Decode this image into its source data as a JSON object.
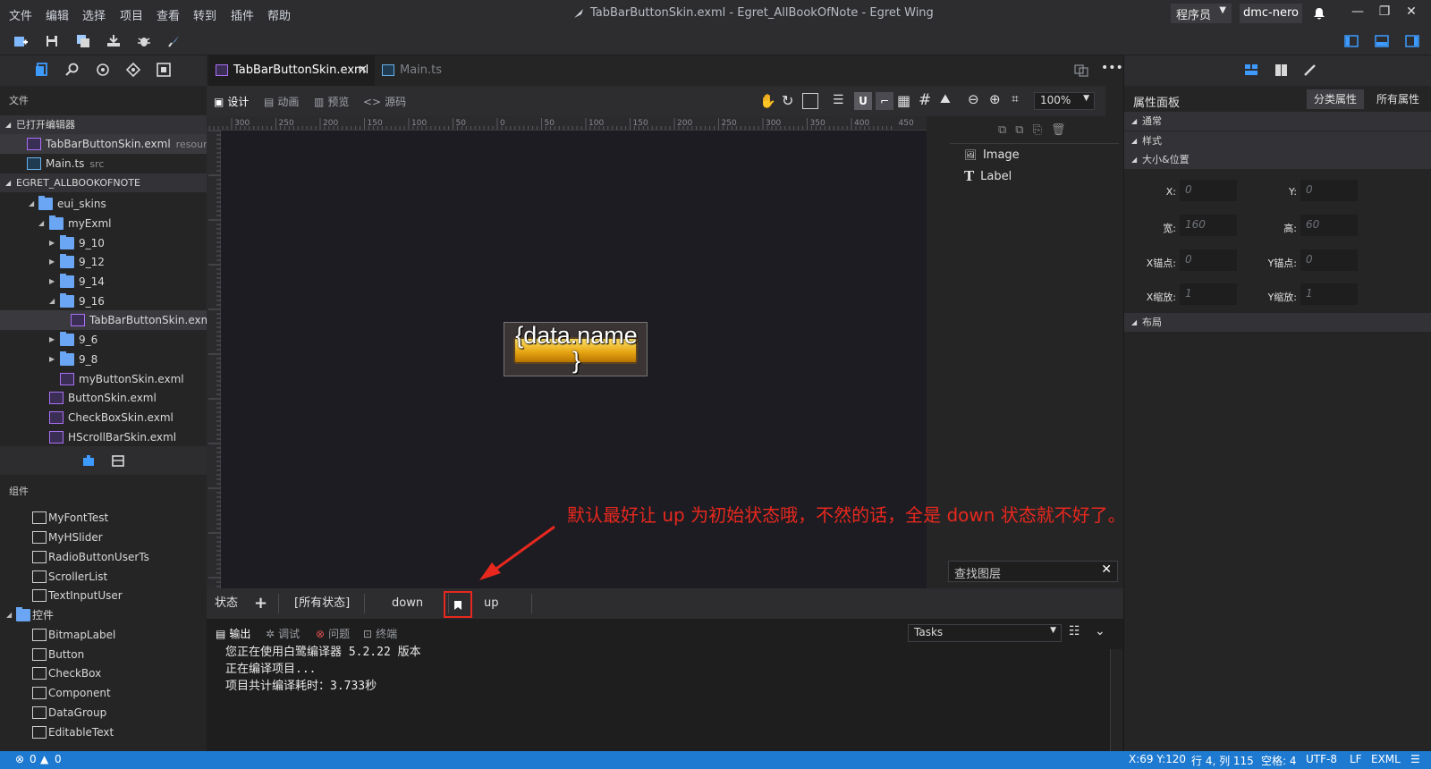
{
  "window": {
    "title": "TabBarButtonSkin.exml - Egret_AllBookOfNote - Egret Wing",
    "role": "程序员",
    "user": "dmc-nero"
  },
  "menu": [
    "文件",
    "编辑",
    "选择",
    "项目",
    "查看",
    "转到",
    "插件",
    "帮助"
  ],
  "explorer": {
    "section_title": "文件",
    "open_editors_header": "已打开编辑器",
    "open_editors": [
      {
        "name": "TabBarButtonSkin.exml",
        "path": "resour..."
      },
      {
        "name": "Main.ts",
        "path": "src"
      }
    ],
    "project_header": "EGRET_ALLBOOKOFNOTE",
    "tree": [
      "eui_skins",
      "myExml",
      "9_10",
      "9_12",
      "9_14",
      "9_16",
      "TabBarButtonSkin.exml",
      "9_6",
      "9_8",
      "myButtonSkin.exml",
      "ButtonSkin.exml",
      "CheckBoxSkin.exml",
      "HScrollBarSkin.exml"
    ]
  },
  "components": {
    "section_title": "组件",
    "custom": [
      "MyFontTest",
      "MyHSlider",
      "RadioButtonUserTs",
      "ScrollerList",
      "TextInputUser"
    ],
    "controls_header": "控件",
    "controls": [
      "BitmapLabel",
      "Button",
      "CheckBox",
      "Component",
      "DataGroup",
      "EditableText"
    ]
  },
  "editor": {
    "tabs": [
      {
        "label": "TabBarButtonSkin.exml",
        "active": true
      },
      {
        "label": "Main.ts",
        "active": false
      }
    ],
    "modes": [
      "设计",
      "动画",
      "预览",
      "源码"
    ],
    "zoom": "100%",
    "ruler_ticks": [
      "300",
      "250",
      "200",
      "150",
      "100",
      "50",
      "0",
      "50",
      "100",
      "150",
      "200",
      "250",
      "300",
      "350",
      "400",
      "450"
    ],
    "preview_label": "{data.name\n}"
  },
  "layers": {
    "items": [
      "Image",
      "Label"
    ],
    "search_placeholder": "查找图层"
  },
  "states": {
    "label": "状态",
    "add": "+",
    "all": "[所有状态]",
    "items": [
      "down",
      "up"
    ]
  },
  "output": {
    "tabs": [
      "输出",
      "调试",
      "问题",
      "终端"
    ],
    "tasks_select": "Tasks",
    "lines": [
      "您正在使用白鹭编译器 5.2.22 版本",
      "正在编译项目...",
      "项目共计编译耗时：3.733秒"
    ]
  },
  "properties": {
    "title": "属性面板",
    "tab_category": "分类属性",
    "tab_all": "所有属性",
    "groups": [
      "通常",
      "样式",
      "大小&位置",
      "布局"
    ],
    "fields": [
      {
        "label": "X:",
        "value": "0"
      },
      {
        "label": "Y:",
        "value": "0"
      },
      {
        "label": "宽:",
        "value": "160"
      },
      {
        "label": "高:",
        "value": "60"
      },
      {
        "label": "X锚点:",
        "value": "0"
      },
      {
        "label": "Y锚点:",
        "value": "0"
      },
      {
        "label": "X缩放:",
        "value": "1"
      },
      {
        "label": "Y缩放:",
        "value": "1"
      }
    ]
  },
  "annotation": "默认最好让 up 为初始状态哦，不然的话，全是 down 状态就不好了。",
  "status_bar": {
    "errors": "0",
    "warnings": "0",
    "coords": "X:69 Y:120",
    "position": "行 4, 列 115",
    "spaces": "空格: 4",
    "encoding": "UTF-8",
    "eol": "LF",
    "language": "EXML"
  },
  "colors": {
    "accent_red": "#e8281e",
    "status_blue": "#1e7ad0",
    "exml_icon": "#a970f5",
    "folder_icon": "#6aa6f3"
  }
}
